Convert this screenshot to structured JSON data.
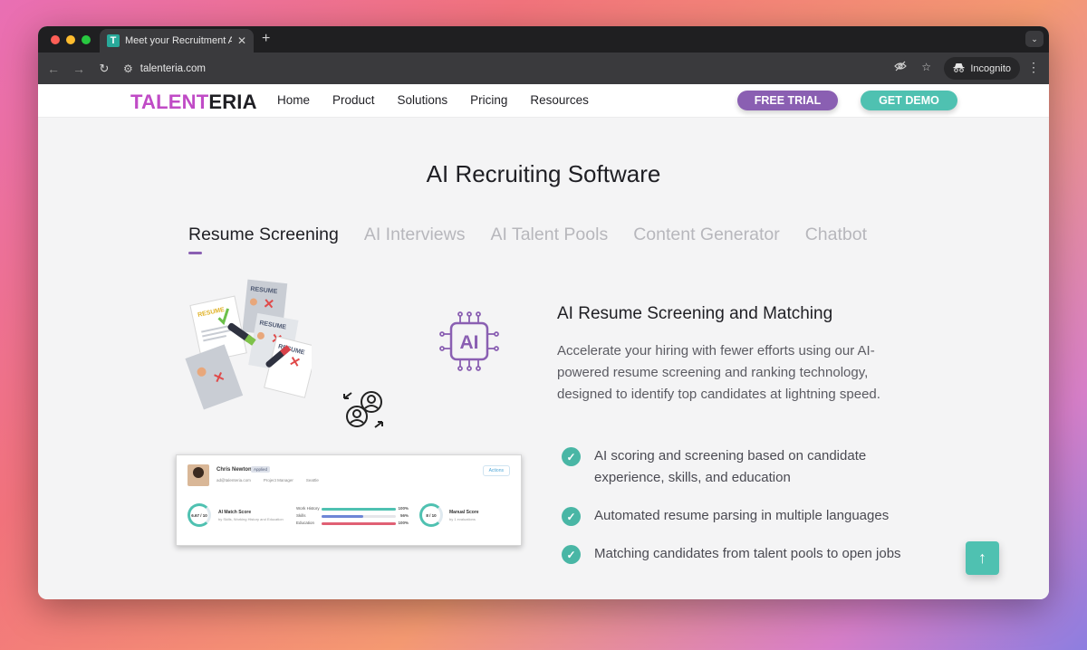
{
  "browser": {
    "tab_title": "Meet your Recruitment AI Co",
    "favicon_letter": "T",
    "url": "talenteria.com",
    "incognito_label": "Incognito"
  },
  "site": {
    "logo_part1": "TALENT",
    "logo_part2": "ERIA",
    "nav": [
      "Home",
      "Product",
      "Solutions",
      "Pricing",
      "Resources"
    ],
    "free_trial": "FREE TRIAL",
    "get_demo": "GET DEMO"
  },
  "main": {
    "section_title": "AI Recruiting Software",
    "tabs": [
      {
        "label": "Resume Screening",
        "active": true
      },
      {
        "label": "AI Interviews",
        "active": false
      },
      {
        "label": "AI Talent Pools",
        "active": false
      },
      {
        "label": "Content Generator",
        "active": false
      },
      {
        "label": "Chatbot",
        "active": false
      }
    ],
    "feature_title": "AI Resume Screening and Matching",
    "feature_desc": "Accelerate your hiring with fewer efforts using our AI-powered resume screening and ranking technology, designed to identify top candidates at lightning speed.",
    "bullets": [
      "AI scoring and screening based on candidate experience, skills, and education",
      "Automated resume parsing in multiple languages",
      "Matching candidates from talent pools to open jobs"
    ]
  },
  "illustration": {
    "resume_label": "RESUME",
    "ai_label": "AI"
  },
  "card": {
    "name": "Chris Newton",
    "status": "Applied",
    "email": "ad@talenteria.com",
    "role": "Project Manager",
    "location": "Seattle",
    "actions_label": "Actions",
    "ai_score": "6.67 / 10",
    "ai_score_title": "AI Match Score",
    "ai_score_sub": "by Skills, Working History and Education",
    "manual_score": "8 / 10",
    "manual_score_title": "Manual Score",
    "manual_score_sub": "by 1 evaluations",
    "bars": [
      {
        "label": "Work History",
        "pct": "100%",
        "value": 1.0,
        "color": "#4fc1b1"
      },
      {
        "label": "Skills",
        "pct": "56%",
        "value": 0.56,
        "color": "#6e86d6"
      },
      {
        "label": "Education",
        "pct": "100%",
        "value": 1.0,
        "color": "#e06074"
      }
    ]
  },
  "colors": {
    "brand_purple": "#8a5fb2",
    "brand_teal": "#4fc1b1",
    "logo_magenta": "#c04bc6"
  }
}
